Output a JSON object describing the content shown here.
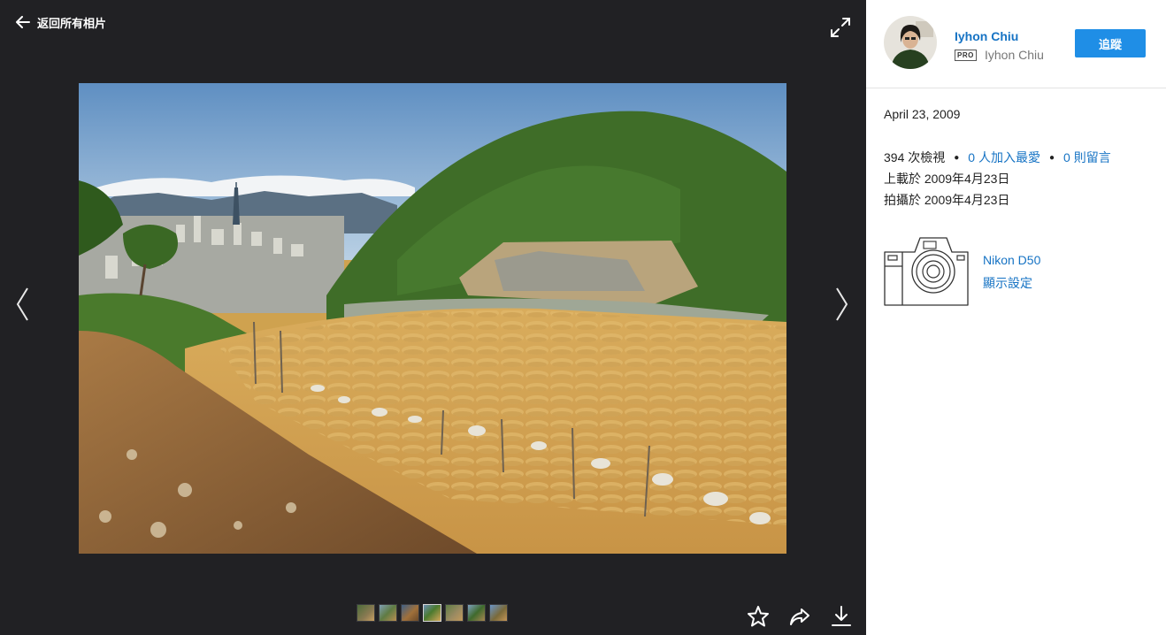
{
  "viewer": {
    "back_label": "返回所有相片",
    "back_icon": "arrow-left-icon",
    "fullscreen_icon": "expand-icon",
    "prev_icon": "chevron-left-icon",
    "next_icon": "chevron-right-icon",
    "filmstrip": {
      "count": 7,
      "active_index": 3
    },
    "actions": [
      {
        "name": "favorite",
        "icon": "star-icon"
      },
      {
        "name": "share",
        "icon": "share-arrow-icon"
      },
      {
        "name": "download",
        "icon": "download-icon"
      }
    ]
  },
  "sidebar": {
    "owner_name": "Iyhon Chiu",
    "pro_badge": "PRO",
    "owner_handle": "Iyhon Chiu",
    "follow_label": "追蹤",
    "taken_date": "April 23, 2009",
    "views": "394 次檢視",
    "faves": "0 人加入最愛",
    "comments": "0 則留言",
    "uploaded": "上載於 2009年4月23日",
    "shot": "拍攝於 2009年4月23日",
    "camera_model": "Nikon D50",
    "show_settings": "顯示設定"
  },
  "colors": {
    "viewer_bg": "#212124",
    "link_blue": "#1673c4",
    "button_blue": "#1f8ee6"
  }
}
